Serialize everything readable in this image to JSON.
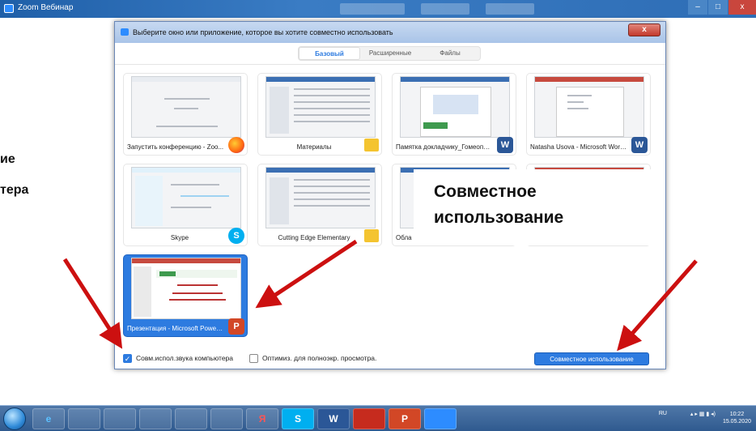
{
  "app_window": {
    "title": "Zoom Вебинар"
  },
  "side_text": {
    "line1": "ие",
    "line2": "тера"
  },
  "dialog": {
    "title": "Выберите окно или приложение, которое вы хотите совместно использовать",
    "close_label": "x",
    "tabs": [
      {
        "label": "Базовый",
        "active": true
      },
      {
        "label": "Расширенные",
        "active": false
      },
      {
        "label": "Файлы",
        "active": false
      }
    ],
    "tiles": [
      {
        "label": "Запустить конференцию - Zoo...",
        "icon": "firefox-icon"
      },
      {
        "label": "Материалы",
        "icon": "folder-icon"
      },
      {
        "label": "Памятка докладчику_Гомеопат...",
        "icon": "word-icon"
      },
      {
        "label": "Natasha Usova - Microsoft Word ...",
        "icon": "word-icon"
      },
      {
        "label": "Skype",
        "icon": "skype-icon"
      },
      {
        "label": "Cutting Edge Elementary",
        "icon": "folder-icon"
      },
      {
        "label": "Обла",
        "icon": ""
      },
      {
        "label": "Презентация - Microsoft PowerP...",
        "icon": "powerpoint-icon",
        "selected": true
      }
    ],
    "share_audio_label": "Совм.испол.звука компьютера",
    "share_audio_checked": true,
    "optimize_label": "Оптимиз. для полноэкр. просмотра.",
    "optimize_checked": false,
    "share_button_label": "Совместное использование"
  },
  "callout": {
    "line1": "Совместное",
    "line2": "использование"
  },
  "taskbar": {
    "apps": [
      "e",
      "",
      "",
      "",
      "",
      "",
      "Я",
      "S",
      "W",
      "",
      "P",
      ""
    ],
    "tray_lang": "RU",
    "clock_time": "10:22",
    "clock_date": "15.05.2020"
  },
  "colors": {
    "accent": "#2d7be0",
    "arrow": "#cc1010"
  }
}
